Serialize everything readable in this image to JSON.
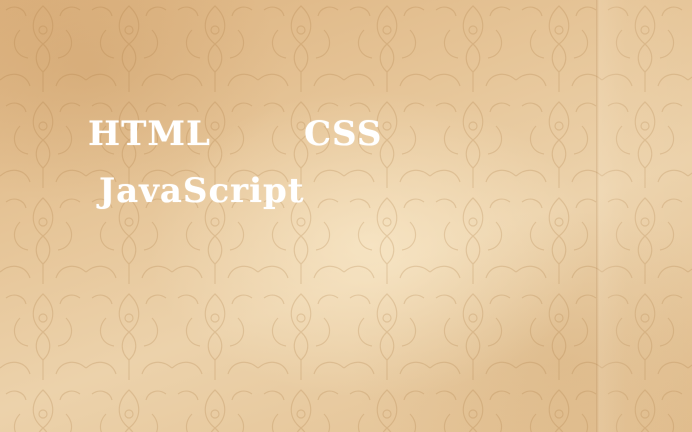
{
  "words": {
    "html": "HTML",
    "css": "CSS",
    "javascript": "JavaScript"
  },
  "colors": {
    "background": "#e6c598",
    "text": "#ffffff"
  }
}
